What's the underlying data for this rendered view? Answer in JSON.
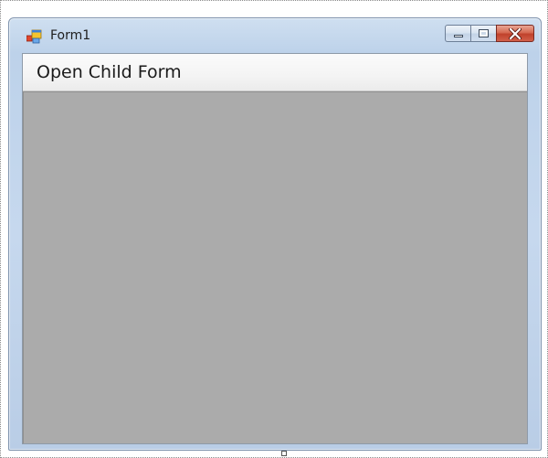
{
  "window": {
    "title": "Form1",
    "icon": "windows-form-icon"
  },
  "caption_buttons": {
    "minimize_icon": "minimize-icon",
    "maximize_icon": "maximize-icon",
    "close_icon": "close-icon"
  },
  "menubar": {
    "items": [
      {
        "label": "Open Child Form"
      }
    ]
  },
  "colors": {
    "mdi_background": "#ababab",
    "close_button": "#c0412b",
    "title_bar": "#c6d8ee"
  }
}
